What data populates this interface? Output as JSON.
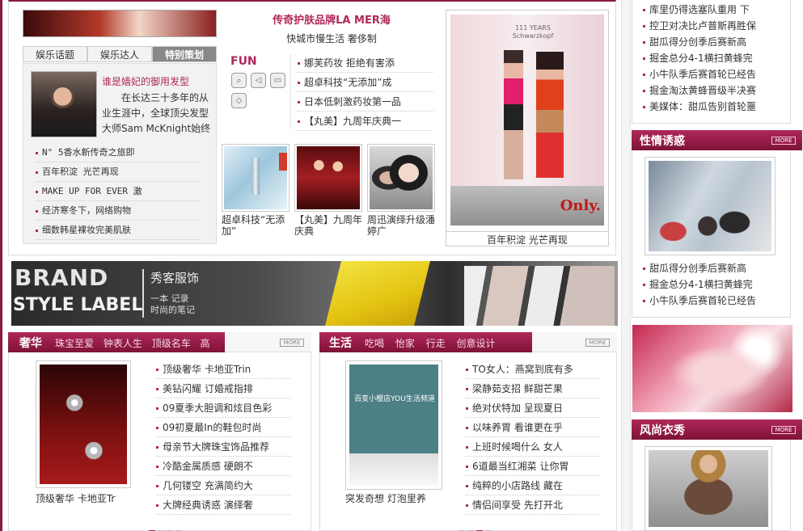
{
  "top_left": {
    "tabs": [
      "娱乐话题",
      "娱乐达人",
      "特别策划"
    ],
    "feature_title": "谁是嫱妃的御用发型",
    "feature_text": "在长达三十多年的从业生涯中，全球顶尖发型大师Sam McKnight始终处",
    "list": [
      "N° 5香水新传奇之旅即",
      "百年积淀 光芒再现",
      "MAKE UP FOR EVER 激",
      "经济寒冬下，网络购物",
      "细数韩星裸妆完美肌肤"
    ]
  },
  "top_center": {
    "headline": "传奇护肤品牌LA MER海",
    "subline": "快城市慢生活 奢侈制",
    "fun_label": "FUN",
    "list": [
      "娜芙药妆 拒绝有害添",
      "超卓科技“无添加”成",
      "日本低刺激药妆第一品",
      "【丸美】九周年庆典一"
    ],
    "thumbs": [
      {
        "caption": "超卓科技“无添加”"
      },
      {
        "caption": "【丸美】九周年庆典"
      },
      {
        "caption": "周迅演绎升级潘婷广"
      }
    ]
  },
  "top_photo": {
    "caption": "百年积淀 光芒再现",
    "brand_mark": "Only.",
    "poster_text": "111 YEARS Schwarzkopf"
  },
  "banner": {
    "line1": "BRAND",
    "line2": "STYLE LABEL",
    "title_cn": "秀客服饰",
    "sub1": "一本 记录",
    "sub2": "时尚的笔记"
  },
  "luxury": {
    "title": "奢华",
    "links": [
      "珠宝至爱",
      "钟表人生",
      "顶级名车",
      "高"
    ],
    "more": "MORE",
    "img_caption": "顶级奢华 卡地亚Tr",
    "list": [
      "顶级奢华 卡地亚Trin",
      "美钻闪耀 订婚戒指排",
      "09夏季大胆调和炫目色彩",
      "09初夏最In的鞋包时尚",
      "母亲节大牌珠宝饰品推荐",
      "冷酷金属质感 硬朗不",
      "几何镂空 充满简约大",
      "大牌经典诱惑 演绎奢"
    ]
  },
  "life": {
    "title": "生活",
    "links": [
      "吃喝",
      "怡家",
      "行走",
      "创意设计"
    ],
    "more": "MORE",
    "img_text": "百变小樱店YOU生活频道",
    "img_caption": "突发奇想 灯泡里养",
    "list": [
      "TO女人：燕窝到底有多",
      "梁静茹支招 鲜甜芒果",
      "绝对伏特加 呈现夏日",
      "以味养胃 看谁更在乎",
      "上班时候喝什么 女人",
      "6道最当红湘菜 让你胃",
      "纯粹的小店路线 藏在",
      "情侣间享受 先打开北"
    ]
  },
  "right_top_list": [
    "库里仍得选塞队重用 下",
    "控卫对决比卢普斯再胜保",
    "甜瓜得分创季后赛新高",
    "掘金总分4-1横扫黄蜂完",
    "小牛队季后赛首轮已经告",
    "掘金淘汰黄蜂晋级半决赛",
    "美媒体：甜瓜告别首轮噩"
  ],
  "xingqing": {
    "title": "性情诱惑",
    "more": "MORE",
    "list": [
      "甜瓜得分创季后赛新高",
      "掘金总分4-1横扫黄蜂完",
      "小牛队季后赛首轮已经告"
    ]
  },
  "fengshang": {
    "title": "风尚衣秀",
    "more": "MORE"
  },
  "pager_luxury_active": 0,
  "pager_life_active": 2,
  "colors": {
    "accent": "#b0285a",
    "dark": "#7e1238"
  }
}
